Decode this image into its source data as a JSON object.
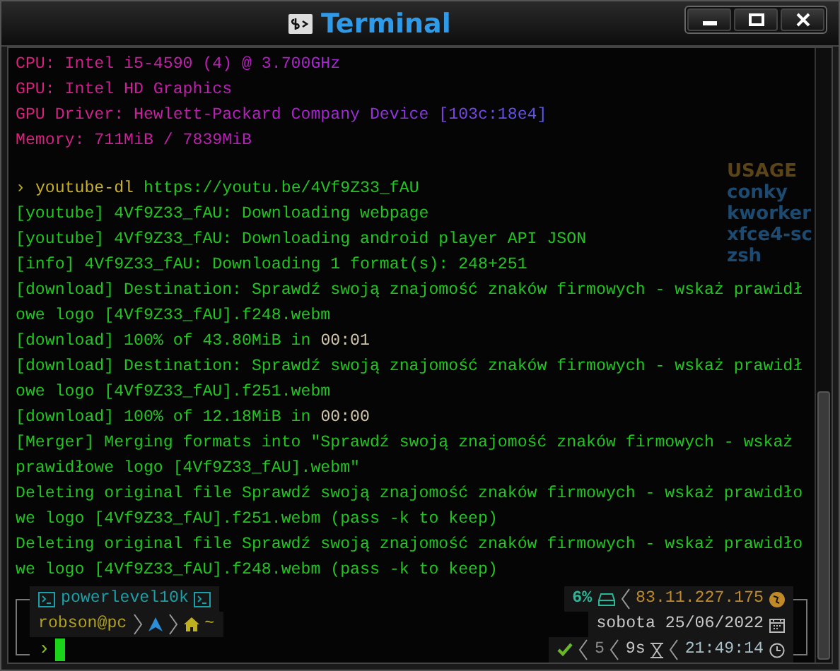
{
  "window": {
    "title": "Terminal"
  },
  "conky": [
    "USAGE",
    "conky",
    "kworker",
    "xfce4-sc",
    "zsh"
  ],
  "system_info": [
    "CPU: Intel i5-4590 (4) @ 3.700GHz",
    "GPU: Intel HD Graphics",
    "GPU Driver: Hewlett-Packard Company Device [103c:18e4]",
    "Memory: 711MiB / 7839MiB"
  ],
  "command": {
    "prompt": "›",
    "program": "youtube-dl",
    "argument": "https://youtu.be/4Vf9Z33_fAU"
  },
  "output": [
    {
      "text": "[youtube] 4Vf9Z33_fAU: Downloading webpage"
    },
    {
      "text": "[youtube] 4Vf9Z33_fAU: Downloading android player API JSON"
    },
    {
      "text": "[info] 4Vf9Z33_fAU: Downloading 1 format(s): 248+251"
    },
    {
      "text": "[download] Destination: Sprawdź swoją znajomość znaków firmowych - wskaż prawidł"
    },
    {
      "text": "owe logo [4Vf9Z33_fAU].f248.webm"
    },
    {
      "text": "[download] 100% of 43.80MiB in ",
      "time": "00:01"
    },
    {
      "text": "[download] Destination: Sprawdź swoją znajomość znaków firmowych - wskaż prawidł"
    },
    {
      "text": "owe logo [4Vf9Z33_fAU].f251.webm"
    },
    {
      "text": "[download] 100% of 12.18MiB in ",
      "time": "00:00"
    },
    {
      "text": "[Merger] Merging formats into \"Sprawdź swoją znajomość znaków firmowych - wskaż"
    },
    {
      "text": "prawidłowe logo [4Vf9Z33_fAU].webm\""
    },
    {
      "text": "Deleting original file Sprawdź swoją znajomość znaków firmowych - wskaż prawidło"
    },
    {
      "text": "we logo [4Vf9Z33_fAU].f251.webm (pass -k to keep)"
    },
    {
      "text": "Deleting original file Sprawdź swoją znajomość znaków firmowych - wskaż prawidło"
    },
    {
      "text": "we logo [4Vf9Z33_fAU].f248.webm (pass -k to keep)"
    }
  ],
  "prompt_left": {
    "context": "powerlevel10k",
    "user": "robson@pc",
    "dir": "~",
    "prompt_char": "›"
  },
  "prompt_right": {
    "disk": "6%",
    "ip": "83.11.227.175",
    "date": "sobota 25/06/2022",
    "status_ok": true,
    "jobs": "5",
    "duration": "9s",
    "time": "21:49:14"
  }
}
